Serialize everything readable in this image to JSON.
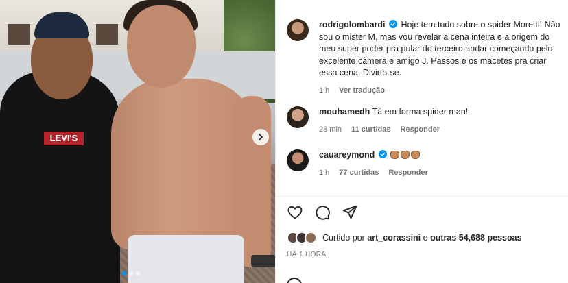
{
  "post": {
    "author": "rodrigolombardi",
    "caption": "Hoje tem tudo sobre o spider Moretti! Não sou o mister M, mas vou revelar a cena inteira e a origem do meu super poder pra pular do terceiro andar começando pelo excelente câmera e amigo J. Passos e os macetes pra criar essa cena. Divirta-se.",
    "time_ago": "1 h",
    "translate_label": "Ver tradução",
    "photo_logo_text": "LEVI'S"
  },
  "comments": [
    {
      "user": "mouhamedh",
      "text": "Tá em forma spider man!",
      "time_ago": "28 min",
      "likes": "11 curtidas",
      "reply_label": "Responder"
    },
    {
      "user": "cauareymond",
      "text": "",
      "emoji_icons": [
        "clapping-hands",
        "clapping-hands",
        "clapping-hands"
      ],
      "time_ago": "1 h",
      "likes": "77 curtidas",
      "reply_label": "Responder"
    }
  ],
  "engagement": {
    "liked_by_prefix": "Curtido por",
    "liked_by_user": "art_corassini",
    "liked_by_joiner": "e",
    "others": "outras 54,688 pessoas",
    "posted_ago": "HÁ 1 HORA"
  },
  "carousel": {
    "slide_count": 3,
    "active_slide": 1
  },
  "colors": {
    "verified_blue": "#0095f6",
    "meta_gray": "#737373",
    "text": "#262626"
  },
  "icons": [
    "heart-icon",
    "comment-icon",
    "share-icon",
    "chevron-right-icon",
    "verified-badge-icon"
  ]
}
